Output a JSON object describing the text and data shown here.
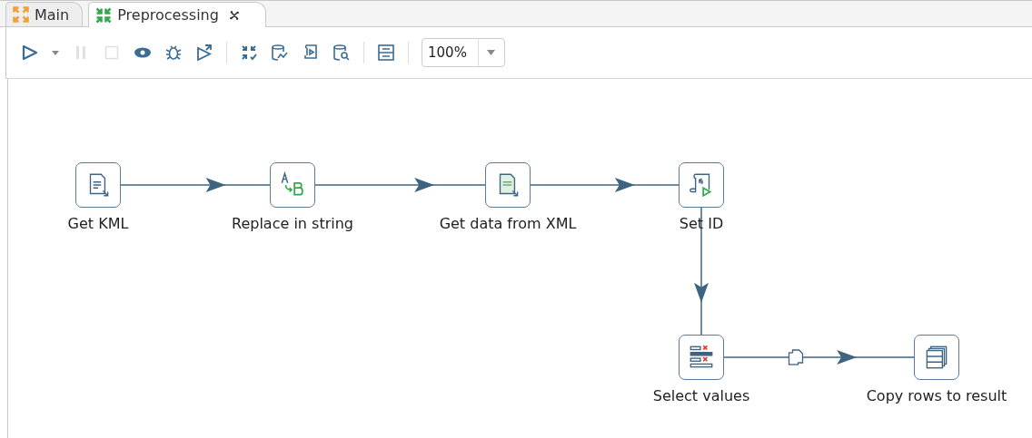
{
  "tabs": [
    {
      "label": "Main",
      "selected": false,
      "closable": false
    },
    {
      "label": "Preprocessing",
      "selected": true,
      "closable": true
    }
  ],
  "toolbar": [
    {
      "kind": "run",
      "disabled": false
    },
    {
      "kind": "caret",
      "disabled": false
    },
    {
      "kind": "pause",
      "disabled": true
    },
    {
      "kind": "stop",
      "disabled": true
    },
    {
      "kind": "preview",
      "disabled": false
    },
    {
      "kind": "debug",
      "disabled": false
    },
    {
      "kind": "replay",
      "disabled": false
    },
    {
      "kind": "separator"
    },
    {
      "kind": "verify",
      "disabled": false
    },
    {
      "kind": "impact",
      "disabled": false
    },
    {
      "kind": "sql",
      "disabled": false
    },
    {
      "kind": "explore",
      "disabled": false
    },
    {
      "kind": "separator"
    },
    {
      "kind": "results",
      "disabled": false
    },
    {
      "kind": "separator"
    }
  ],
  "zoom": {
    "value": "100%"
  },
  "steps": [
    {
      "label": "Get KML",
      "kind": "text-file",
      "hop": {
        "kind": "normal"
      }
    },
    {
      "label": "Replace in string",
      "kind": "replace",
      "hop": {
        "kind": "normal"
      }
    },
    {
      "label": "Get data from XML",
      "kind": "xml",
      "hop": {
        "kind": "normal"
      }
    },
    {
      "label": "Set ID",
      "kind": "script",
      "hop": {
        "kind": "normal"
      }
    },
    {
      "label": "Select values",
      "kind": "select",
      "hop": {
        "kind": "copy"
      }
    },
    {
      "label": "Copy rows to result",
      "kind": "copy-rows"
    }
  ]
}
